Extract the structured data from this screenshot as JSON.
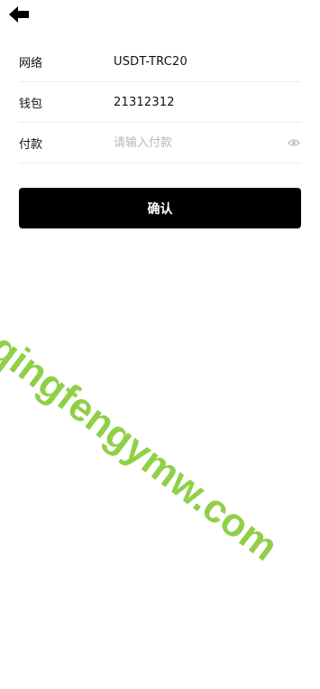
{
  "nav": {
    "back_icon": "back-arrow-icon"
  },
  "form": {
    "network": {
      "label": "网络",
      "value": "USDT-TRC20"
    },
    "wallet": {
      "label": "钱包",
      "value": "21312312"
    },
    "payment": {
      "label": "付款",
      "placeholder": "请输入付款",
      "value": "",
      "toggle_icon": "eye-icon"
    }
  },
  "confirm_button": {
    "label": "确认",
    "bg_color": "#000000",
    "text_color": "#ffffff"
  },
  "watermark": {
    "text": "qingfengymw.com",
    "color": "#7CC828"
  }
}
